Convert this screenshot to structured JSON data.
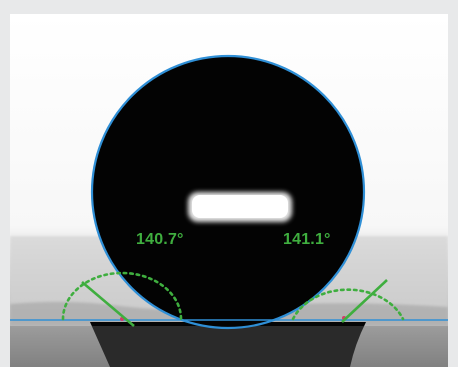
{
  "measurement": {
    "left_angle_label": "140.7°",
    "right_angle_label": "141.1°",
    "left_angle_value": 140.7,
    "right_angle_value": 141.1
  },
  "colors": {
    "frame": "#e8e9ea",
    "drop": "#030303",
    "fit_circle": "#2f8fd6",
    "baseline": "#2f8fd6",
    "tangent": "#3fae3f",
    "angle_arc": "#3fae3f",
    "highlight": "#ffffff"
  }
}
